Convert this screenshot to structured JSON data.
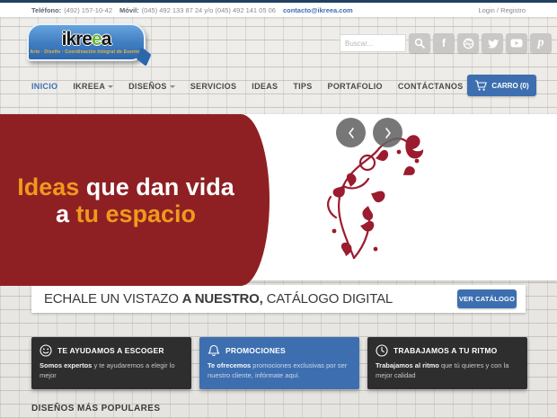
{
  "topbar": {
    "phone_label": "Teléfono:",
    "phone": "(492) 157-10-42",
    "mobile_label": "Móvil:",
    "mobile": "(045) 492 133 87 24 y/o (045) 492 141 05 06",
    "email": "contacto@ikreea.com",
    "login": "Login / Registro"
  },
  "logo": {
    "word_start": "ikre",
    "word_green": "e",
    "word_end": "a",
    "tagline": "Arte · Diseño · Coordinación Integral de Eventos"
  },
  "search": {
    "placeholder": "Buscar..."
  },
  "social": {
    "facebook": "f",
    "pinterest": "p"
  },
  "nav": {
    "items": [
      {
        "label": "INICIO",
        "active": true,
        "dropdown": false
      },
      {
        "label": "IKREEA",
        "active": false,
        "dropdown": true
      },
      {
        "label": "DISEÑOS",
        "active": false,
        "dropdown": true
      },
      {
        "label": "SERVICIOS",
        "active": false,
        "dropdown": false
      },
      {
        "label": "IDEAS",
        "active": false,
        "dropdown": false
      },
      {
        "label": "TIPS",
        "active": false,
        "dropdown": false
      },
      {
        "label": "PORTAFOLIO",
        "active": false,
        "dropdown": false
      },
      {
        "label": "CONTÁCTANOS",
        "active": false,
        "dropdown": false
      }
    ],
    "cart_label": "CARRO (0)"
  },
  "hero": {
    "line1_accent": "Ideas",
    "line1_rest": " que dan vida",
    "line2_pre": "a ",
    "line2_accent": "tu espacio"
  },
  "catalog": {
    "text_1": "ECHALE UN VISTAZO ",
    "text_bold": "A NUESTRO,",
    "text_2": " CATÁLOGO DIGITAL",
    "button": "VER CATÁLOGO"
  },
  "features": [
    {
      "icon": "smiley-icon",
      "title": "TE AYUDAMOS A ESCOGER",
      "body_bold": "Somos expertos",
      "body_rest": " y te ayudaremos a elegir lo mejor"
    },
    {
      "icon": "bell-icon",
      "title": "PROMOCIONES",
      "body_bold": "Te ofrecemos",
      "body_rest": " promociones exclusivas por ser nuestro cliente, infórmate aquí."
    },
    {
      "icon": "clock-icon",
      "title": "TRABAJAMOS A TU RITMO",
      "body_bold": "Trabajamos al ritmo",
      "body_rest": " que tú quieres y con la mejor calidad"
    }
  ],
  "section_title": "DISEÑOS MÁS POPULARES",
  "colors": {
    "accent_blue": "#3d6fb0",
    "hero_red": "#8e2023",
    "floral_red": "#9b1b2f",
    "accent_orange": "#f0991e",
    "logo_green": "#6db32c",
    "navy_line": "#21405f",
    "dark_box": "#2e2e2e"
  }
}
